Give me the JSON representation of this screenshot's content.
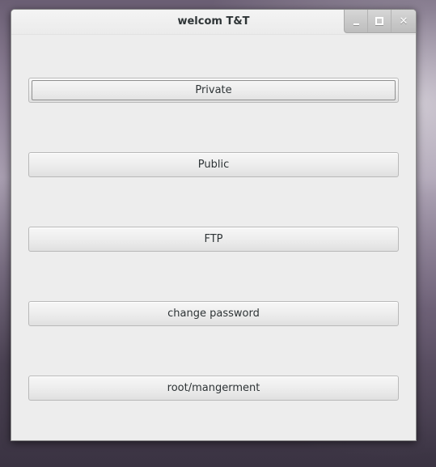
{
  "window": {
    "title": "welcom T&T"
  },
  "controls": {
    "minimize_icon": "minimize-icon",
    "maximize_icon": "maximize-icon",
    "close_icon": "close-icon",
    "close_glyph": "✕"
  },
  "buttons": [
    {
      "label": "Private",
      "focused": true
    },
    {
      "label": "Public",
      "focused": false
    },
    {
      "label": "FTP",
      "focused": false
    },
    {
      "label": "change password",
      "focused": false
    },
    {
      "label": "root/mangerment",
      "focused": false
    }
  ]
}
